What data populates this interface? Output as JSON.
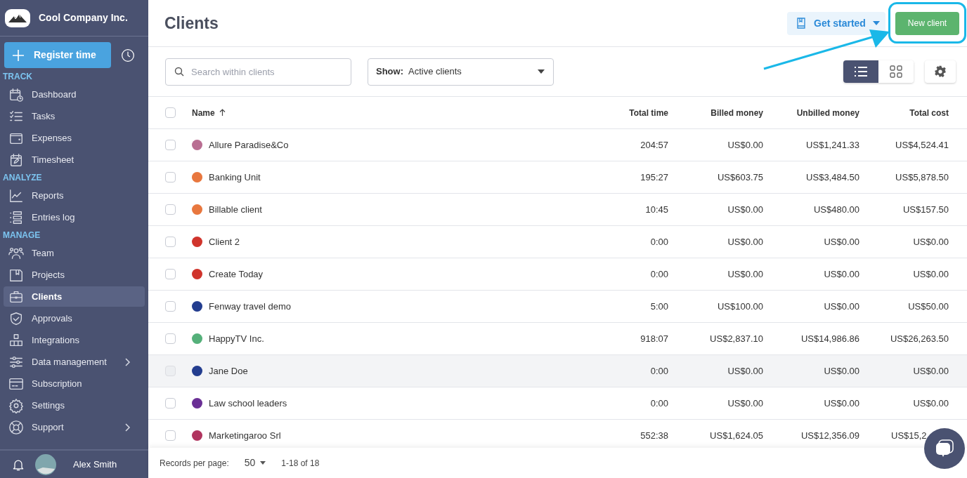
{
  "company": {
    "name": "Cool Company Inc."
  },
  "register_button": {
    "label": "Register time"
  },
  "sidebar": {
    "sections": [
      {
        "heading": "TRACK",
        "items": [
          {
            "label": "Dashboard",
            "selected": false,
            "submenu": false
          },
          {
            "label": "Tasks",
            "selected": false,
            "submenu": false
          },
          {
            "label": "Expenses",
            "selected": false,
            "submenu": false
          },
          {
            "label": "Timesheet",
            "selected": false,
            "submenu": false
          }
        ]
      },
      {
        "heading": "ANALYZE",
        "items": [
          {
            "label": "Reports",
            "selected": false,
            "submenu": false
          },
          {
            "label": "Entries log",
            "selected": false,
            "submenu": false
          }
        ]
      },
      {
        "heading": "MANAGE",
        "items": [
          {
            "label": "Team",
            "selected": false,
            "submenu": false
          },
          {
            "label": "Projects",
            "selected": false,
            "submenu": false
          },
          {
            "label": "Clients",
            "selected": true,
            "submenu": false
          },
          {
            "label": "Approvals",
            "selected": false,
            "submenu": false
          },
          {
            "label": "Integrations",
            "selected": false,
            "submenu": false
          },
          {
            "label": "Data management",
            "selected": false,
            "submenu": true
          },
          {
            "label": "Subscription",
            "selected": false,
            "submenu": false
          },
          {
            "label": "Settings",
            "selected": false,
            "submenu": false
          },
          {
            "label": "Support",
            "selected": false,
            "submenu": true
          }
        ]
      }
    ]
  },
  "user": {
    "name": "Alex Smith"
  },
  "page_title": "Clients",
  "get_started": {
    "label": "Get started"
  },
  "new_client": {
    "label": "New client"
  },
  "search": {
    "placeholder": "Search within clients"
  },
  "filter": {
    "label": "Show:",
    "value": "Active clients"
  },
  "view_toggle": [
    {
      "selected": true
    },
    {
      "selected": false
    }
  ],
  "table": {
    "all_checked": false,
    "columns": [
      "Name",
      "Total time",
      "Billed money",
      "Unbilled money",
      "Total cost"
    ],
    "rows": [
      {
        "name": "Allure Paradise&Co",
        "color": "#b96e92",
        "total_time": "204:57",
        "billed": "US$0.00",
        "unbilled": "US$1,241.33",
        "total_cost": "US$4,524.41",
        "highlighted": false
      },
      {
        "name": "Banking Unit",
        "color": "#e8773e",
        "total_time": "195:27",
        "billed": "US$603.75",
        "unbilled": "US$3,484.50",
        "total_cost": "US$5,878.50",
        "highlighted": false
      },
      {
        "name": "Billable client",
        "color": "#e8773e",
        "total_time": "10:45",
        "billed": "US$0.00",
        "unbilled": "US$480.00",
        "total_cost": "US$157.50",
        "highlighted": false
      },
      {
        "name": "Client 2",
        "color": "#d0342c",
        "total_time": "0:00",
        "billed": "US$0.00",
        "unbilled": "US$0.00",
        "total_cost": "US$0.00",
        "highlighted": false
      },
      {
        "name": "Create Today",
        "color": "#d0342c",
        "total_time": "0:00",
        "billed": "US$0.00",
        "unbilled": "US$0.00",
        "total_cost": "US$0.00",
        "highlighted": false
      },
      {
        "name": "Fenway travel demo",
        "color": "#233d8f",
        "total_time": "5:00",
        "billed": "US$100.00",
        "unbilled": "US$0.00",
        "total_cost": "US$50.00",
        "highlighted": false
      },
      {
        "name": "HappyTV Inc.",
        "color": "#55b07a",
        "total_time": "918:07",
        "billed": "US$2,837.10",
        "unbilled": "US$14,986.86",
        "total_cost": "US$26,263.50",
        "highlighted": false
      },
      {
        "name": "Jane Doe",
        "color": "#233d8f",
        "total_time": "0:00",
        "billed": "US$0.00",
        "unbilled": "US$0.00",
        "total_cost": "US$0.00",
        "highlighted": true
      },
      {
        "name": "Law school leaders",
        "color": "#6a2f95",
        "total_time": "0:00",
        "billed": "US$0.00",
        "unbilled": "US$0.00",
        "total_cost": "US$0.00",
        "highlighted": false
      },
      {
        "name": "Marketingaroo Srl",
        "color": "#b0345f",
        "total_time": "552:38",
        "billed": "US$1,624.05",
        "unbilled": "US$12,356.09",
        "total_cost": "US$15,2",
        "highlighted": false,
        "cost_cut": true
      }
    ]
  },
  "footer": {
    "label": "Records per page:",
    "per_page": "50",
    "range": "1-18 of 18"
  }
}
